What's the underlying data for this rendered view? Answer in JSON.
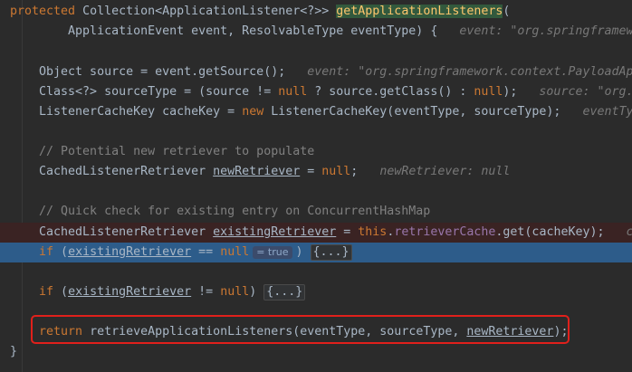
{
  "lines": [
    {
      "id": "l1",
      "parts": [
        {
          "t": "protected",
          "c": "kw"
        },
        {
          "t": " Collection<ApplicationListener<?>> "
        },
        {
          "t": "getApplicationListeners",
          "c": "hl-decl"
        },
        {
          "t": "("
        }
      ]
    },
    {
      "id": "l2",
      "parts": [
        {
          "t": "        ApplicationEvent event, ResolvableType eventType) {   "
        },
        {
          "t": "event: \"org.springframework.context.PayloadApplicationEvent\"",
          "c": "hint"
        }
      ]
    },
    {
      "id": "l3",
      "parts": []
    },
    {
      "id": "l4",
      "parts": [
        {
          "t": "    Object source = event.getSource();   "
        },
        {
          "t": "event: \"org.springframework.context.PayloadApplicationEvent\"",
          "c": "hint"
        }
      ]
    },
    {
      "id": "l5",
      "parts": [
        {
          "t": "    Class<?> sourceType = (source != "
        },
        {
          "t": "null",
          "c": "kw"
        },
        {
          "t": " ? source.getClass() : "
        },
        {
          "t": "null",
          "c": "kw"
        },
        {
          "t": ");   "
        },
        {
          "t": "source: \"org.springframework\"",
          "c": "hint"
        }
      ]
    },
    {
      "id": "l6",
      "parts": [
        {
          "t": "    ListenerCacheKey cacheKey = "
        },
        {
          "t": "new",
          "c": "kw"
        },
        {
          "t": " ListenerCacheKey(eventType, sourceType);   "
        },
        {
          "t": "eventType: \"org.springframework\"",
          "c": "hint"
        }
      ]
    },
    {
      "id": "l7",
      "parts": []
    },
    {
      "id": "l8",
      "parts": [
        {
          "t": "    // Potential new retriever to populate",
          "c": "comment"
        }
      ]
    },
    {
      "id": "l9",
      "parts": [
        {
          "t": "    CachedListenerRetriever "
        },
        {
          "t": "newRetriever",
          "c": "ul"
        },
        {
          "t": " = "
        },
        {
          "t": "null",
          "c": "kw"
        },
        {
          "t": ";   "
        },
        {
          "t": "newRetriever: null",
          "c": "hint"
        }
      ]
    },
    {
      "id": "l10",
      "parts": []
    },
    {
      "id": "l11",
      "parts": [
        {
          "t": "    // Quick check for existing entry on ConcurrentHashMap",
          "c": "comment"
        }
      ]
    },
    {
      "id": "l12",
      "row": "row-bp",
      "parts": [
        {
          "t": "    CachedListenerRetriever "
        },
        {
          "t": "existingRetriever",
          "c": "ul"
        },
        {
          "t": " = "
        },
        {
          "t": "this",
          "c": "kw"
        },
        {
          "t": "."
        },
        {
          "t": "retrieverCache",
          "c": "field"
        },
        {
          "t": ".get(cacheKey);   "
        },
        {
          "t": "cacheKey: \"org.springframework\"",
          "c": "hint"
        }
      ]
    },
    {
      "id": "l13",
      "row": "row-exec",
      "parts": [
        {
          "t": "    "
        },
        {
          "t": "if",
          "c": "kw"
        },
        {
          "t": " ("
        },
        {
          "t": "existingRetriever",
          "c": "ul"
        },
        {
          "t": " == "
        },
        {
          "t": "null",
          "c": "kw"
        },
        {
          "t": "= true",
          "c": "inlay"
        },
        {
          "t": ") "
        },
        {
          "t": "{...}",
          "c": "fold"
        }
      ]
    },
    {
      "id": "l14",
      "parts": []
    },
    {
      "id": "l15",
      "parts": [
        {
          "t": "    "
        },
        {
          "t": "if",
          "c": "kw"
        },
        {
          "t": " ("
        },
        {
          "t": "existingRetriever",
          "c": "ul"
        },
        {
          "t": " != "
        },
        {
          "t": "null",
          "c": "kw"
        },
        {
          "t": ") "
        },
        {
          "t": "{...}",
          "c": "fold"
        }
      ]
    },
    {
      "id": "l16",
      "parts": []
    },
    {
      "id": "l17",
      "parts": [
        {
          "t": "    "
        },
        {
          "t": "return",
          "c": "kw"
        },
        {
          "t": " retrieveApplicationListeners(eventType, sourceType, "
        },
        {
          "t": "newRetriever",
          "c": "ul"
        },
        {
          "t": ");"
        }
      ]
    },
    {
      "id": "l18",
      "parts": [
        {
          "t": "}",
          "c": "brace"
        }
      ]
    }
  ]
}
